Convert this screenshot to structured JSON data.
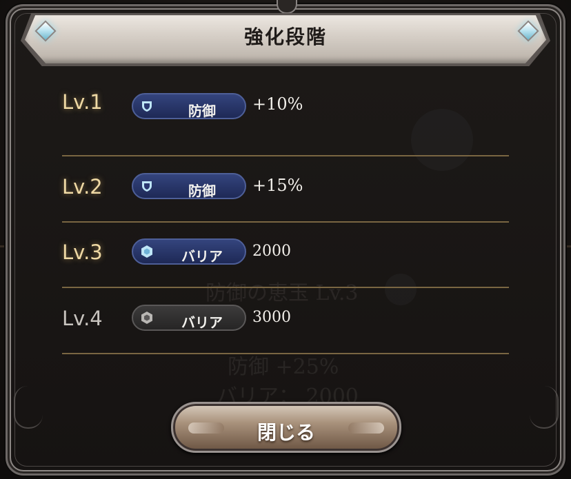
{
  "title": "強化段階",
  "close_label": "閉じる",
  "rows": [
    {
      "level": "Lv.1",
      "badge": "防御",
      "badge_icon": "shield-icon",
      "value": "+10%",
      "active": true
    },
    {
      "level": "Lv.2",
      "badge": "防御",
      "badge_icon": "shield-icon",
      "value": "+15%",
      "active": true
    },
    {
      "level": "Lv.3",
      "badge": "バリア",
      "badge_icon": "hexagon-icon",
      "value": "2000",
      "active": true
    },
    {
      "level": "Lv.4",
      "badge": "バリア",
      "badge_icon": "hexagon-icon",
      "value": "3000",
      "active": false
    }
  ],
  "background": {
    "item_name": "防御の恵玉 Lv.3",
    "stat_line": "防御 +25%",
    "barrier_line": "バリア： 2000"
  },
  "colors": {
    "level_active": "#efd9a4",
    "level_inactive": "#c8c4bf",
    "badge_active": "#2a3770",
    "badge_inactive": "#303030",
    "divider": "#7a6642"
  }
}
